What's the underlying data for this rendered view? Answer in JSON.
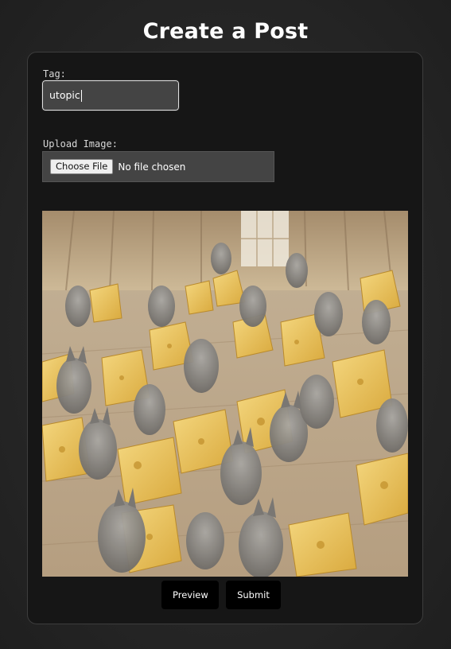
{
  "page": {
    "title": "Create a Post"
  },
  "form": {
    "tag_label": "Tag:",
    "tag_value": "utopic",
    "upload_label": "Upload Image:",
    "file_button_label": "Choose File",
    "file_status": "No file chosen"
  },
  "preview": {
    "image_icon": "image-preview-icon",
    "description_colors": {
      "wood": "#c9b89a",
      "cheese": "#e8c25a",
      "cat": "#8c8a88"
    }
  },
  "actions": {
    "preview_label": "Preview",
    "submit_label": "Submit"
  },
  "colors": {
    "background": "#262626",
    "card": "#161616",
    "input": "#444444",
    "button": "#000000"
  }
}
